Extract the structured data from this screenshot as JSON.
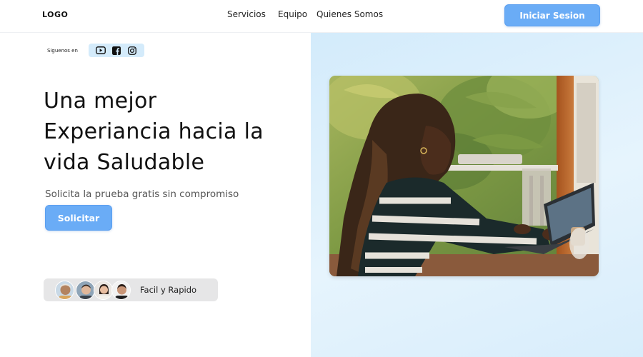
{
  "header": {
    "logo": "LOGO",
    "nav": [
      {
        "label": "Servicios"
      },
      {
        "label": "Equipo"
      },
      {
        "label": "Quienes Somos"
      }
    ],
    "login_label": "Iniciar Sesion"
  },
  "social": {
    "label": "Siguenos en",
    "icons": [
      "youtube-icon",
      "facebook-icon",
      "instagram-icon"
    ]
  },
  "hero": {
    "headline": [
      "Una mejor",
      "Experiancia hacia la",
      "vida Saludable"
    ],
    "subtitle": "Solicita la prueba gratis sin compromiso",
    "cta_label": "Solicitar",
    "pill_label": "Facil y Rapido",
    "avatar_count": 4
  },
  "colors": {
    "accent": "#6aacf6",
    "panel": "#d8edfb",
    "pill": "#e6e6e7"
  }
}
